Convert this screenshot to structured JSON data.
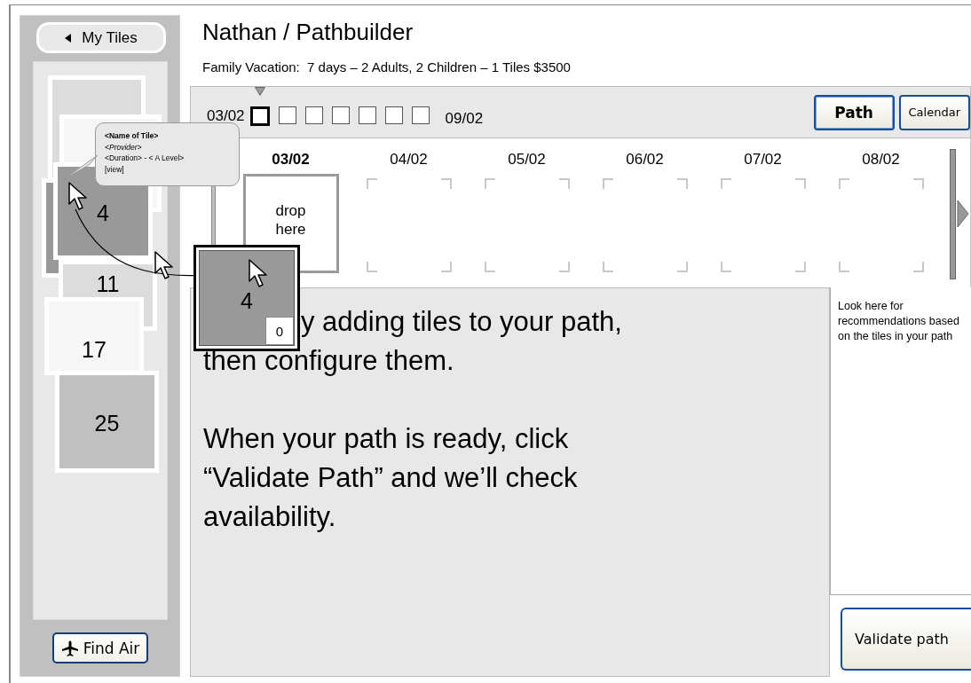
{
  "sidebar": {
    "back_button": "My Tiles",
    "tiles": [
      {
        "color": "#dcdcdc"
      },
      {
        "color": "#f6f6f6"
      },
      {
        "color": "#999999"
      },
      {
        "color": "#999999",
        "number": "4"
      },
      {
        "color": "#dcdcdc",
        "number": "11"
      },
      {
        "color": "#f6f6f6",
        "number": "17"
      },
      {
        "color": "#c0c0c0",
        "number": "25"
      }
    ],
    "find_air_button": "Find Air"
  },
  "header": {
    "title": "Nathan / Pathbuilder",
    "subtitle": "Family Vacation:  7 days – 2 Adults, 2 Children – 1 Tiles $3500"
  },
  "toolbar": {
    "start_date": "03/02",
    "end_date": "09/02",
    "days": [
      {
        "selected": true
      },
      {
        "selected": false
      },
      {
        "selected": false
      },
      {
        "selected": false
      },
      {
        "selected": false
      },
      {
        "selected": false
      },
      {
        "selected": false
      }
    ],
    "views": [
      {
        "label": "Path",
        "selected": true
      },
      {
        "label": "Calendar",
        "selected": false
      }
    ]
  },
  "timeline": {
    "columns": [
      {
        "date": "03/02",
        "selected": true,
        "drop_hint": "drop here"
      },
      {
        "date": "04/02",
        "selected": false
      },
      {
        "date": "05/02",
        "selected": false
      },
      {
        "date": "06/02",
        "selected": false
      },
      {
        "date": "07/02",
        "selected": false
      },
      {
        "date": "08/02",
        "selected": false
      }
    ]
  },
  "instructions": [
    "y adding tiles to your path,",
    "then configure them.",
    "When your path is ready, click “Validate Path” and we’ll check availability."
  ],
  "recommendations": "Look here for recommendations based on the tiles in your path",
  "validate_button": "Validate path",
  "tooltip": {
    "name": "<Name of Tile>",
    "provider": "<Provider>",
    "detail": "<Duration> - < A Level>",
    "link": "[view]"
  },
  "dragged_tile": {
    "number": "4",
    "count": "0"
  }
}
